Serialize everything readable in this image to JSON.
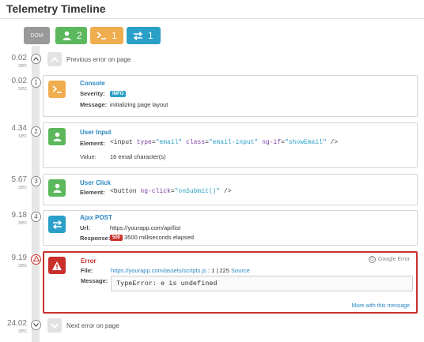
{
  "header": {
    "title": "Telemetry Timeline"
  },
  "filters": {
    "dom_label": "DOM",
    "user_count": "2",
    "console_count": "1",
    "network_count": "1"
  },
  "nav": {
    "previous": {
      "time": "0.02",
      "unit": "sec",
      "label": "Previous error on page"
    },
    "next": {
      "time": "24.02",
      "unit": "sec",
      "label": "Next error on page"
    }
  },
  "events": [
    {
      "index": "1",
      "time": "0.02",
      "unit": "sec",
      "type": "console",
      "title": "Console",
      "severity_label": "Severity:",
      "severity": "INFO",
      "message_label": "Message:",
      "message": "initializing page layout"
    },
    {
      "index": "2",
      "time": "4.34",
      "unit": "sec",
      "type": "user",
      "title": "User Input",
      "element_label": "Element:",
      "element": {
        "open": "<input ",
        "attrs": [
          [
            "type",
            "\"email\""
          ],
          [
            "class",
            "\"email-input\""
          ],
          [
            "ng-if",
            "\"showEmail\""
          ]
        ],
        "close": " />"
      },
      "value_label": "Value:",
      "value": "16 email character(s)"
    },
    {
      "index": "3",
      "time": "5.67",
      "unit": "sec",
      "type": "user",
      "title": "User Click",
      "element_label": "Element:",
      "element": {
        "open": "<button ",
        "attrs": [
          [
            "ng-click",
            "\"onSubmit()\""
          ]
        ],
        "close": " />"
      }
    },
    {
      "index": "4",
      "time": "9.18",
      "unit": "sec",
      "type": "network",
      "title": "Ajax POST",
      "url_label": "Url:",
      "url": "https://yourapp.com/api/list",
      "response_label": "Response:",
      "status": "500",
      "response": "3500 milliseconds elapsed"
    },
    {
      "index": "",
      "time": "9.19",
      "unit": "sec",
      "type": "error",
      "title": "Error",
      "google_label": "Google Error",
      "file_label": "File:",
      "file": "https://yourapp.com/assets/scripts.js",
      "line": " : 1 | 225 ",
      "source_label": "Source",
      "message_label": "Message:",
      "message": "TypeError: e is undefined",
      "more_label": "More with this message"
    }
  ],
  "colors": {
    "user": "#5cb85c",
    "console": "#f0ad4e",
    "network": "#2aa0c8",
    "error": "#c9302c",
    "dom": "#999999"
  }
}
